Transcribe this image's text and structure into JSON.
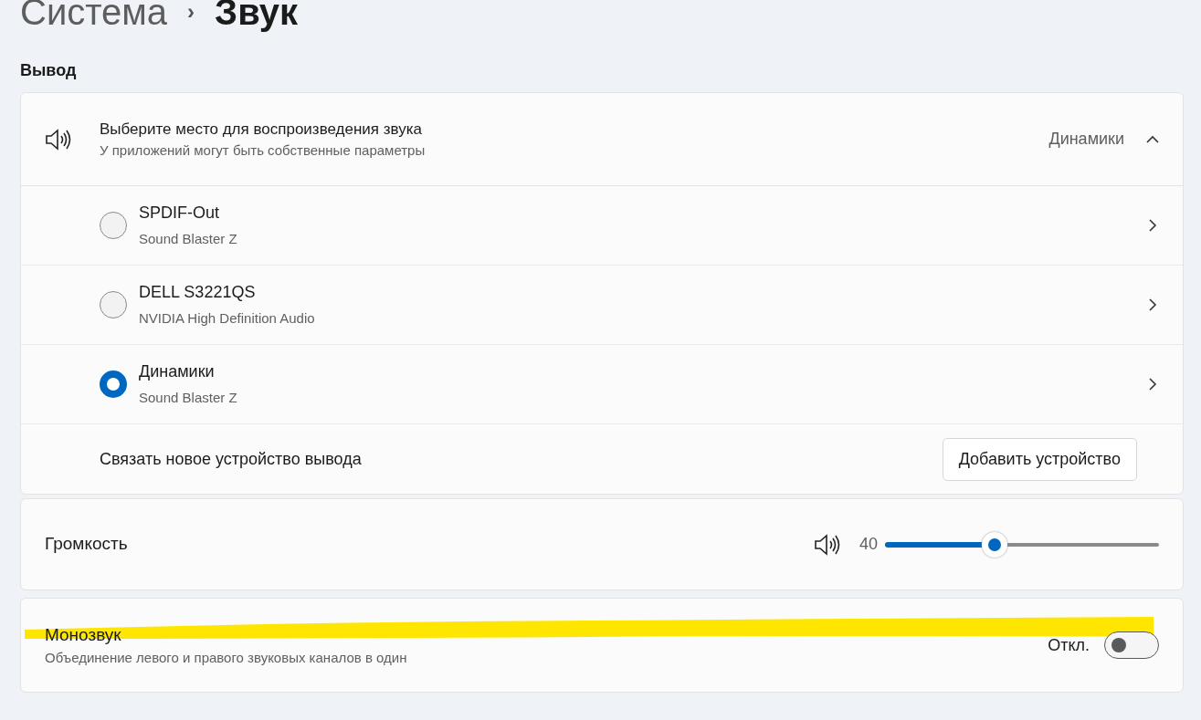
{
  "breadcrumb": {
    "parent": "Система",
    "separator": "›",
    "current": "Звук"
  },
  "section_title": "Вывод",
  "output": {
    "title": "Выберите место для воспроизведения звука",
    "subtitle": "У приложений могут быть собственные параметры",
    "value": "Динамики",
    "expanded": true,
    "devices": [
      {
        "name": "SPDIF-Out",
        "detail": "Sound Blaster Z",
        "selected": false
      },
      {
        "name": "DELL S3221QS",
        "detail": "NVIDIA High Definition Audio",
        "selected": false
      },
      {
        "name": "Динамики",
        "detail": "Sound Blaster Z",
        "selected": true
      }
    ],
    "pair_label": "Связать новое устройство вывода",
    "pair_button": "Добавить устройство"
  },
  "volume": {
    "label": "Громкость",
    "reading": "40",
    "level": 0.4
  },
  "mono": {
    "title": "Монозвук",
    "subtitle": "Объединение левого и правого звуковых каналов в один",
    "state_label": "Откл.",
    "on": false,
    "highlighted": true
  }
}
